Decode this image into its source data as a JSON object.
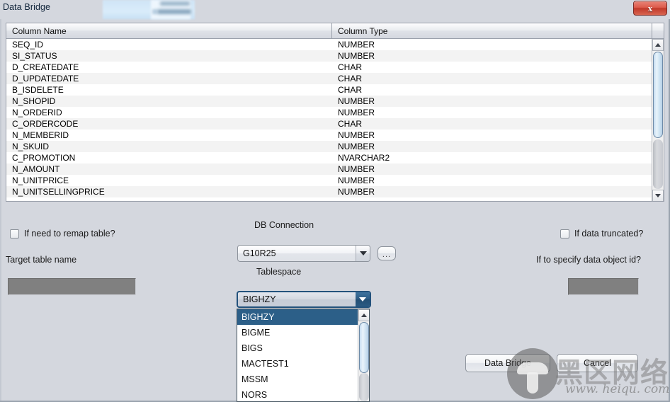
{
  "window": {
    "title": "Data Bridge",
    "close_label": "x"
  },
  "table": {
    "headers": [
      "Column Name",
      "Column Type"
    ],
    "rows": [
      {
        "name": "SEQ_ID",
        "type": "NUMBER"
      },
      {
        "name": "SI_STATUS",
        "type": "NUMBER"
      },
      {
        "name": "D_CREATEDATE",
        "type": "CHAR"
      },
      {
        "name": "D_UPDATEDATE",
        "type": "CHAR"
      },
      {
        "name": "B_ISDELETE",
        "type": "CHAR"
      },
      {
        "name": "N_SHOPID",
        "type": "NUMBER"
      },
      {
        "name": "N_ORDERID",
        "type": "NUMBER"
      },
      {
        "name": "C_ORDERCODE",
        "type": "CHAR"
      },
      {
        "name": "N_MEMBERID",
        "type": "NUMBER"
      },
      {
        "name": "N_SKUID",
        "type": "NUMBER"
      },
      {
        "name": "C_PROMOTION",
        "type": "NVARCHAR2"
      },
      {
        "name": "N_AMOUNT",
        "type": "NUMBER"
      },
      {
        "name": "N_UNITPRICE",
        "type": "NUMBER"
      },
      {
        "name": "N_UNITSELLINGPRICE",
        "type": "NUMBER"
      }
    ]
  },
  "form": {
    "remap_checkbox_label": "If need to remap table?",
    "target_table_label": "Target table name",
    "target_table_value": "",
    "db_connection_label": "DB Connection",
    "db_connection_value": "G10R25",
    "browse_button_label": "...",
    "tablespace_label": "Tablespace",
    "tablespace_value": "BIGHZY",
    "truncated_checkbox_label": "If data truncated?",
    "data_object_id_label": "If to specify data object id?",
    "data_object_id_value": ""
  },
  "tablespace_dropdown": {
    "selected": "BIGHZY",
    "options": [
      "BIGHZY",
      "BIGME",
      "BIGS",
      "MACTEST1",
      "MSSM",
      "NORS"
    ]
  },
  "buttons": {
    "primary": "Data Bridge",
    "cancel": "Cancel"
  },
  "watermark": {
    "brand_cn": "黑区网络",
    "url": "www. heiqu. com"
  },
  "colors": {
    "panel_bg": "#d4d7de",
    "accent_selected": "#2c5f88",
    "close_red": "#c1382a",
    "disabled_field": "#808080"
  }
}
